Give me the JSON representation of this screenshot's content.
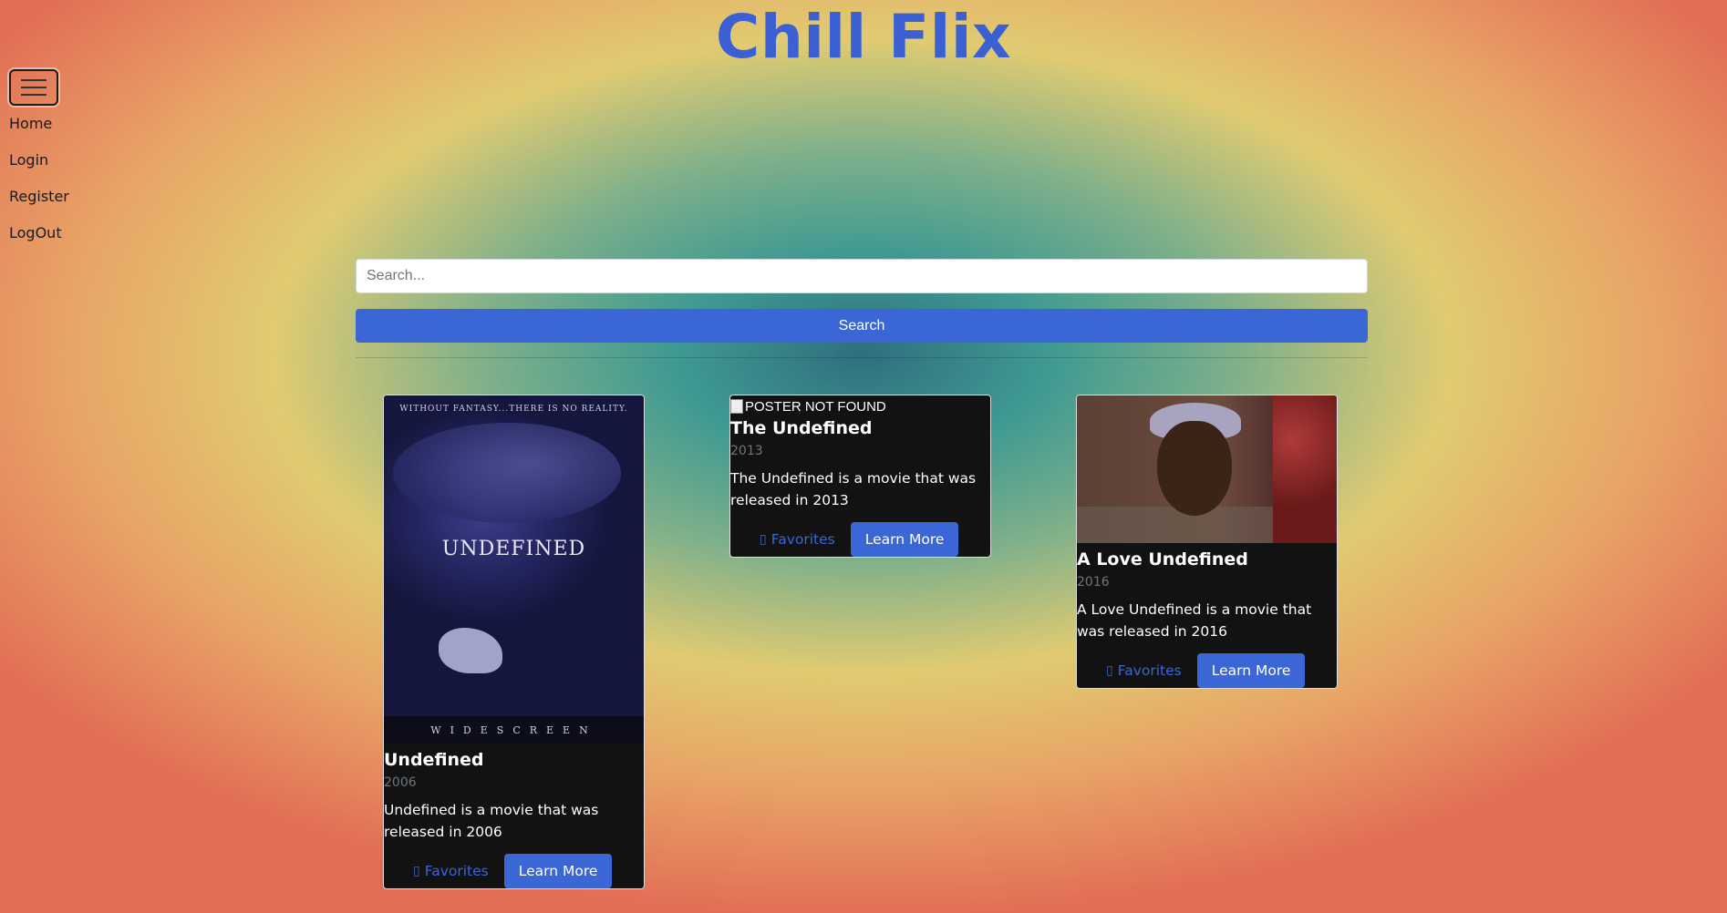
{
  "app": {
    "title": "Chill Flix"
  },
  "nav": {
    "items": [
      "Home",
      "Login",
      "Register",
      "LogOut"
    ]
  },
  "search": {
    "placeholder": "Search...",
    "button_label": "Search"
  },
  "movies": [
    {
      "title": "Undefined",
      "year": "2006",
      "description": "Undefined is a movie that was released in 2006",
      "poster_text": {
        "tagline": "WITHOUT FANTASY...THERE IS NO REALITY.",
        "name": "UNDEFINED",
        "footer": "WIDESCREEN"
      },
      "favorites_label": "Favorites",
      "learn_more_label": "Learn More"
    },
    {
      "title": "The Undefined",
      "year": "2013",
      "description": "The Undefined is a movie that was released in 2013",
      "poster_alt": "POSTER NOT FOUND",
      "favorites_label": "Favorites",
      "learn_more_label": "Learn More"
    },
    {
      "title": "A Love Undefined",
      "year": "2016",
      "description": "A Love Undefined is a movie that was released in 2016",
      "favorites_label": "Favorites",
      "learn_more_label": "Learn More"
    }
  ],
  "colors": {
    "accent": "#3b66d6",
    "card_bg": "#121212",
    "title": "#3a60d4"
  },
  "icons": {
    "menu": "hamburger-icon",
    "favorite": "heart-icon"
  }
}
